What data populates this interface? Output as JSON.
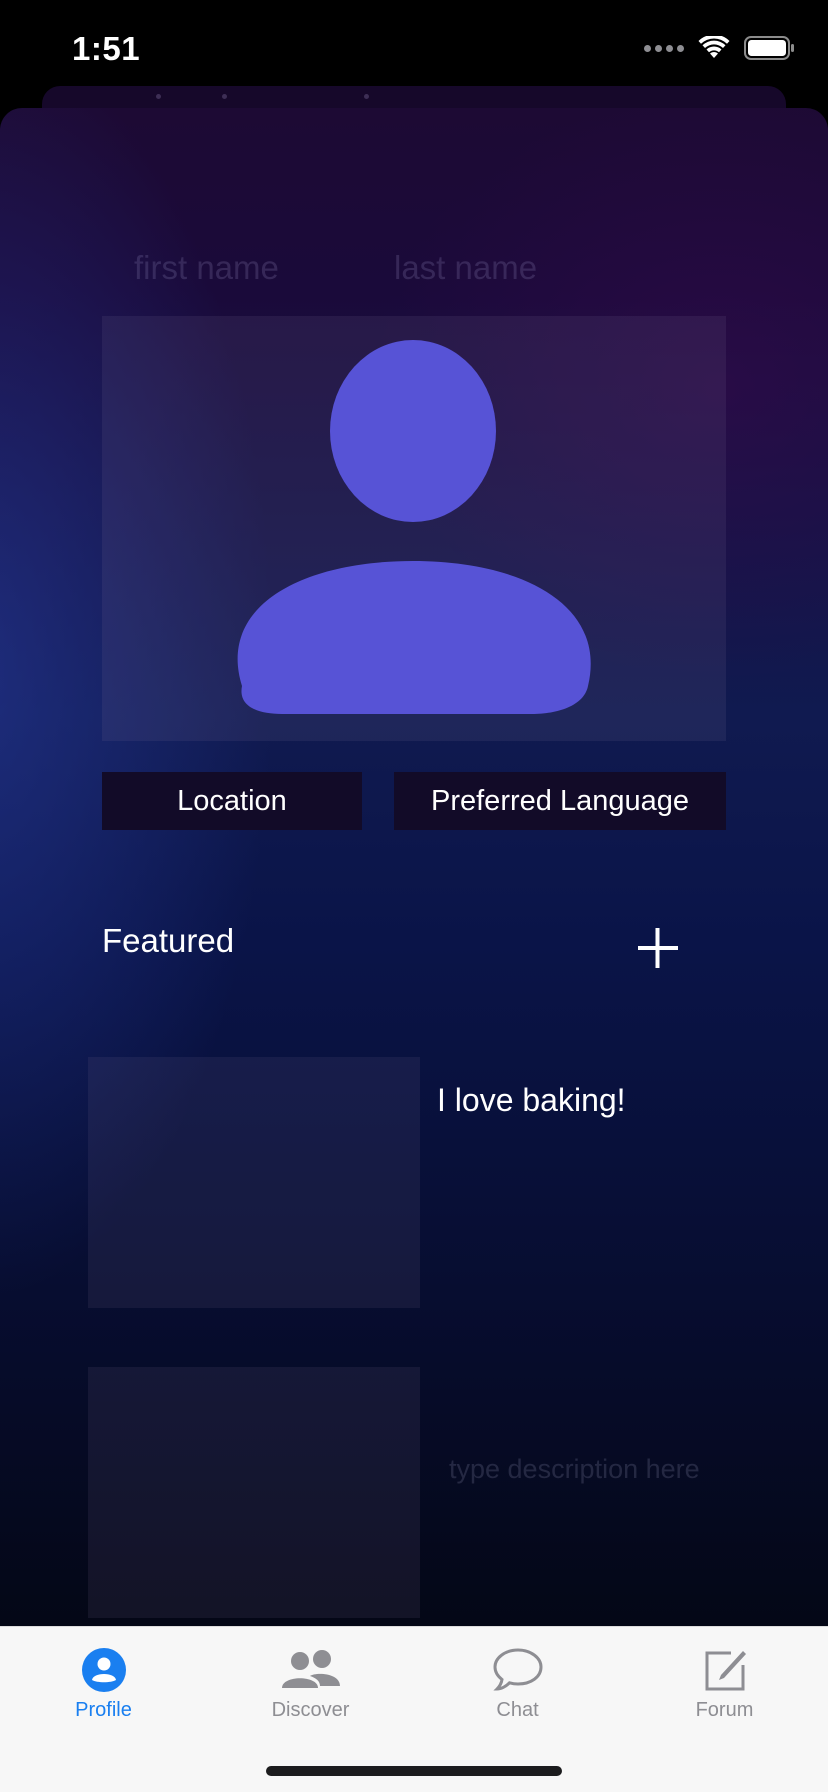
{
  "status_bar": {
    "time": "1:51"
  },
  "profile": {
    "first_name_placeholder": "first name",
    "last_name_placeholder": "last name",
    "location_label": "Location",
    "language_label": "Preferred Language",
    "avatar_color": "#5753d6"
  },
  "featured": {
    "title": "Featured",
    "items": [
      {
        "text": "I love baking!"
      },
      {
        "placeholder": "type description here"
      }
    ]
  },
  "tab_bar": {
    "active_color": "#1a7ff0",
    "inactive_color": "#8e8e93",
    "tabs": [
      {
        "label": "Profile",
        "icon": "profile-icon",
        "active": true
      },
      {
        "label": "Discover",
        "icon": "people-icon",
        "active": false
      },
      {
        "label": "Chat",
        "icon": "chat-bubble-icon",
        "active": false
      },
      {
        "label": "Forum",
        "icon": "compose-icon",
        "active": false
      }
    ]
  }
}
